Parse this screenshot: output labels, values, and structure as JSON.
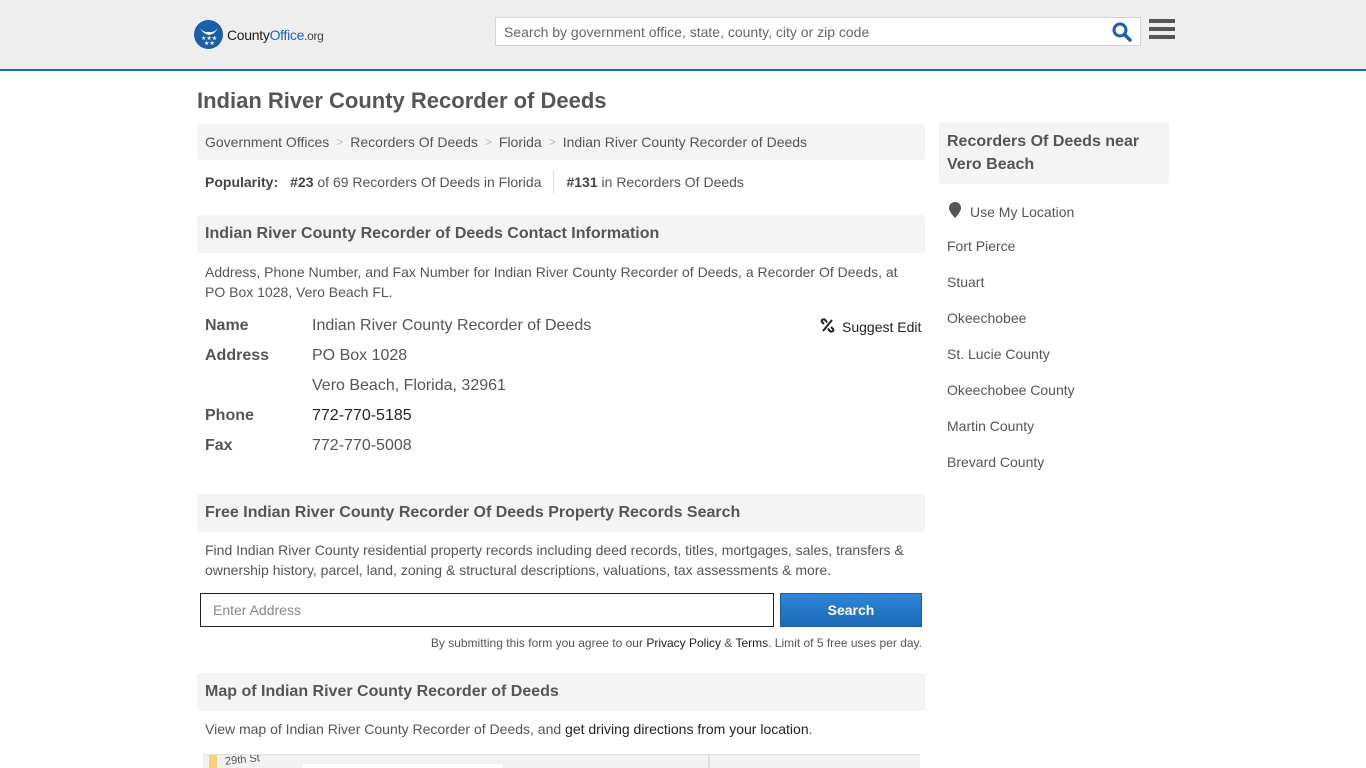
{
  "header": {
    "logo": {
      "name": "County",
      "brand": "Office",
      "tld": ".org"
    },
    "search_placeholder": "Search by government office, state, county, city or zip code",
    "accent_color": "#1b6ab5"
  },
  "page": {
    "title": "Indian River County Recorder of Deeds",
    "breadcrumb": [
      "Government Offices",
      "Recorders Of Deeds",
      "Florida",
      "Indian River County Recorder of Deeds"
    ],
    "popularity": {
      "label": "Popularity:",
      "state_rank": "#23",
      "state_text": "of 69 Recorders Of Deeds in Florida",
      "national_rank": "#131",
      "national_text": "in Recorders Of Deeds"
    }
  },
  "contact": {
    "heading": "Indian River County Recorder of Deeds Contact Information",
    "description": "Address, Phone Number, and Fax Number for Indian River County Recorder of Deeds, a Recorder Of Deeds, at PO Box 1028, Vero Beach FL.",
    "suggest_edit": "Suggest Edit",
    "rows": [
      {
        "label": "Name",
        "value": "Indian River County Recorder of Deeds"
      },
      {
        "label": "Address",
        "value": "PO Box 1028"
      },
      {
        "label": "",
        "value": "Vero Beach, Florida, 32961"
      },
      {
        "label": "Phone",
        "value": "772-770-5185"
      },
      {
        "label": "Fax",
        "value": "772-770-5008"
      }
    ]
  },
  "property_search": {
    "heading": "Free Indian River County Recorder Of Deeds Property Records Search",
    "description": "Find Indian River County residential property records including deed records, titles, mortgages, sales, transfers & ownership history, parcel, land, zoning & structural descriptions, valuations, tax assessments & more.",
    "input_placeholder": "Enter Address",
    "button_label": "Search",
    "disclaimer_prefix": "By submitting this form you agree to our ",
    "privacy_link": "Privacy Policy",
    "amp": " & ",
    "terms_link": "Terms",
    "disclaimer_suffix": ". Limit of 5 free uses per day."
  },
  "map_section": {
    "heading": "Map of Indian River County Recorder of Deeds",
    "text_prefix": "View map of Indian River County Recorder of Deeds, and ",
    "directions_link": "get driving directions from your location",
    "text_suffix": ".",
    "street_label": "29th St"
  },
  "sidebar": {
    "heading": "Recorders Of Deeds near Vero Beach",
    "use_location": "Use My Location",
    "links": [
      "Fort Pierce",
      "Stuart",
      "Okeechobee",
      "St. Lucie County",
      "Okeechobee County",
      "Martin County",
      "Brevard County"
    ]
  }
}
